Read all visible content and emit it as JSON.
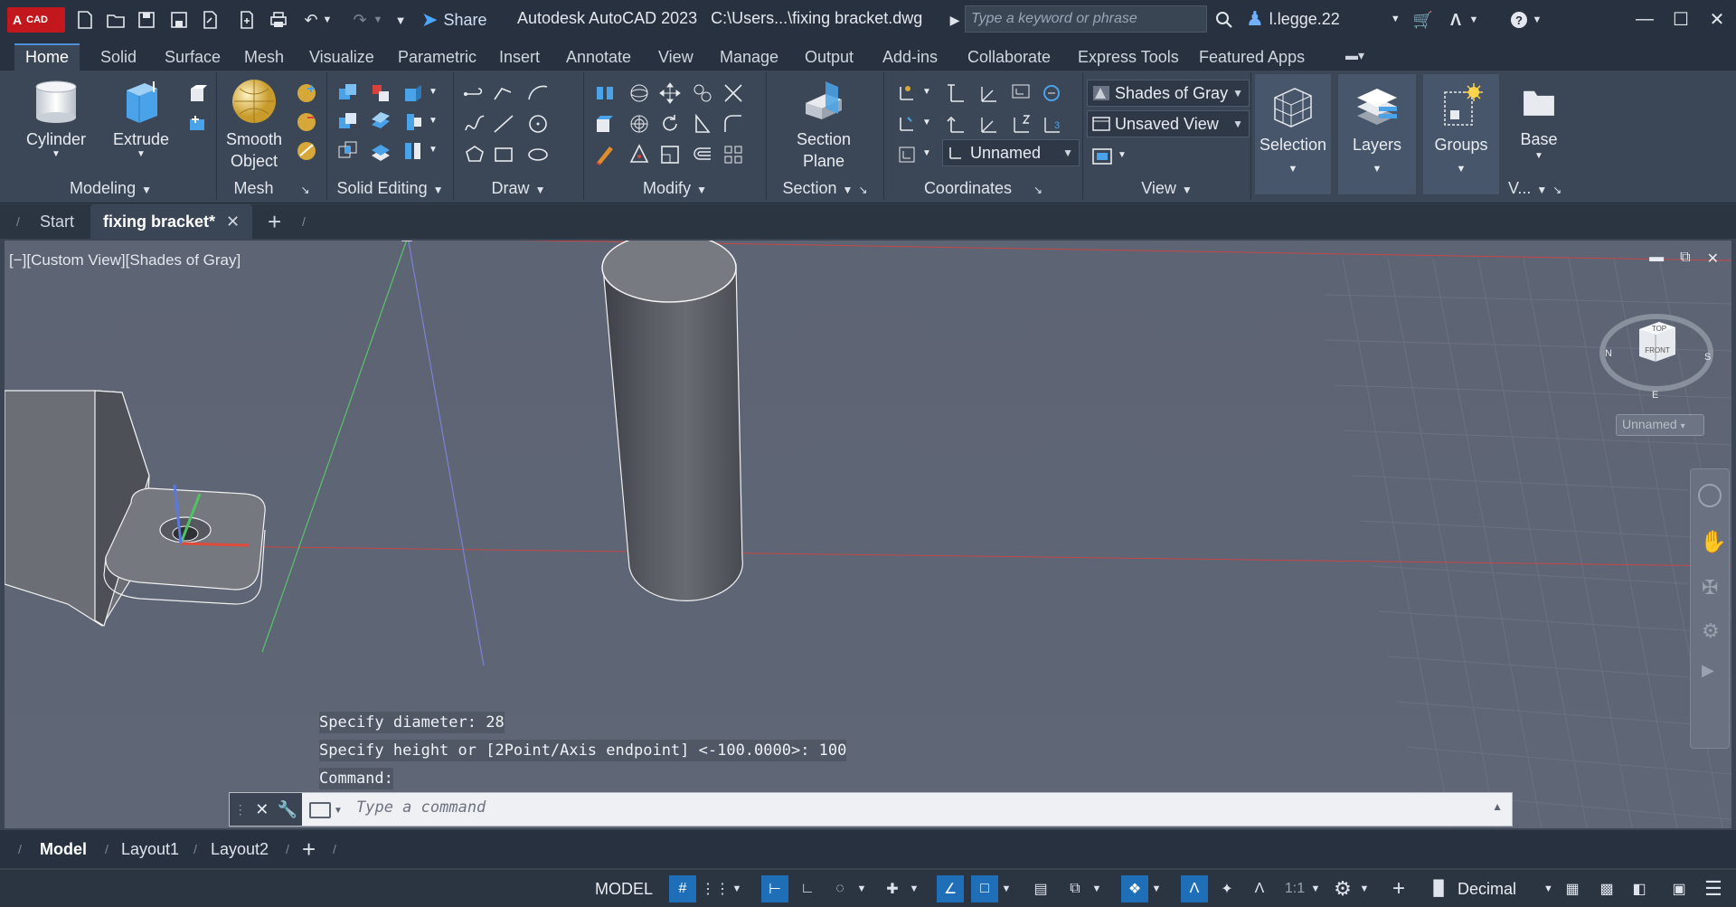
{
  "titlebar": {
    "logo_text": "A",
    "logo_sub": "CAD",
    "share_label": "Share",
    "app_title": "Autodesk AutoCAD 2023",
    "file_path": "C:\\Users...\\fixing bracket.dwg",
    "search_placeholder": "Type a keyword or phrase",
    "username": "l.legge.22"
  },
  "ribbon_tabs": [
    "Home",
    "Solid",
    "Surface",
    "Mesh",
    "Visualize",
    "Parametric",
    "Insert",
    "Annotate",
    "View",
    "Manage",
    "Output",
    "Add-ins",
    "Collaborate",
    "Express Tools",
    "Featured Apps"
  ],
  "ribbon": {
    "modeling": {
      "title": "Modeling",
      "cylinder": "Cylinder",
      "extrude": "Extrude"
    },
    "mesh": {
      "title": "Mesh",
      "smooth_object_1": "Smooth",
      "smooth_object_2": "Object"
    },
    "solid_editing": {
      "title": "Solid Editing"
    },
    "draw": {
      "title": "Draw"
    },
    "modify": {
      "title": "Modify"
    },
    "section": {
      "title": "Section",
      "section_plane_1": "Section",
      "section_plane_2": "Plane"
    },
    "coordinates": {
      "title": "Coordinates",
      "ucs_dropdown": "Unnamed"
    },
    "view": {
      "title": "View",
      "visual_style": "Shades of Gray",
      "named_view": "Unsaved View"
    },
    "selection": {
      "label": "Selection"
    },
    "layers": {
      "label": "Layers"
    },
    "groups": {
      "label": "Groups"
    },
    "base": {
      "label": "Base",
      "title": "V..."
    }
  },
  "file_tabs": {
    "start": "Start",
    "active": "fixing bracket*"
  },
  "viewport": {
    "label": "[−][Custom View][Shades of Gray]",
    "viewcube_top": "TOP",
    "viewcube_front": "FRONT",
    "compass_n": "N",
    "compass_s": "S",
    "compass_e": "E",
    "named_view_btn": "Unnamed"
  },
  "command": {
    "history": [
      "Specify diameter: 28",
      "Specify height or [2Point/Axis endpoint] <-100.0000>: 100",
      "Command:"
    ],
    "placeholder": "Type a command"
  },
  "layout_tabs": [
    "Model",
    "Layout1",
    "Layout2"
  ],
  "statusbar": {
    "model": "MODEL",
    "scale": "1:1",
    "units": "Decimal"
  },
  "colors": {
    "accent": "#1f6fb8",
    "logo_red": "#c2171c",
    "viewport_bg": "#5f6676"
  }
}
